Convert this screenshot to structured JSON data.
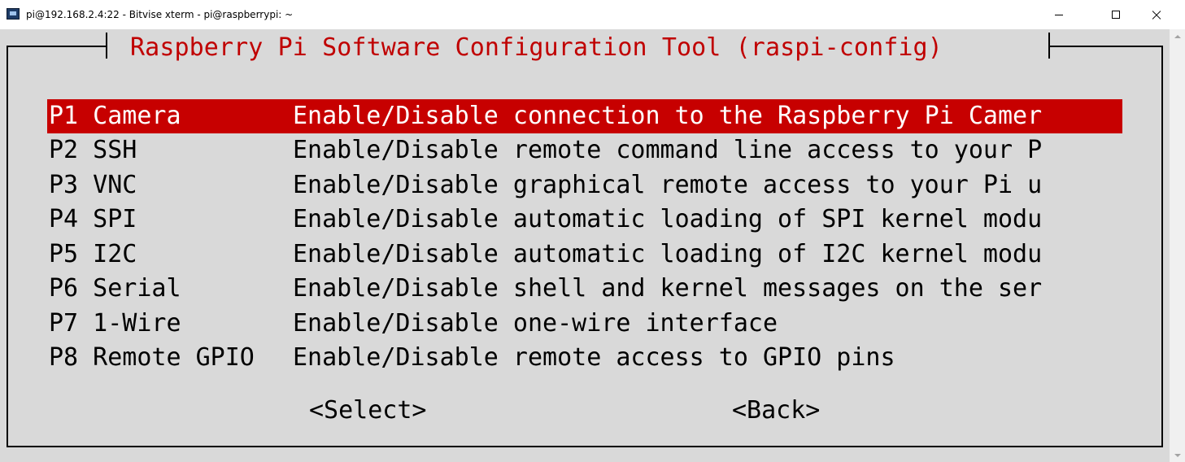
{
  "window": {
    "title": "pi@192.168.2.4:22 - Bitvise xterm - pi@raspberrypi: ~",
    "app_icon": "terminal-icon",
    "controls": {
      "minimize_icon": "minimize-icon",
      "maximize_icon": "maximize-icon",
      "close_icon": "close-icon"
    }
  },
  "dialog": {
    "title": "Raspberry Pi Software Configuration Tool (raspi-config)",
    "items": [
      {
        "key": "P1 Camera",
        "description": "Enable/Disable connection to the Raspberry Pi Camer",
        "selected": true
      },
      {
        "key": "P2 SSH",
        "description": "Enable/Disable remote command line access to your P",
        "selected": false
      },
      {
        "key": "P3 VNC",
        "description": "Enable/Disable graphical remote access to your Pi u",
        "selected": false
      },
      {
        "key": "P4 SPI",
        "description": "Enable/Disable automatic loading of SPI kernel modu",
        "selected": false
      },
      {
        "key": "P5 I2C",
        "description": "Enable/Disable automatic loading of I2C kernel modu",
        "selected": false
      },
      {
        "key": "P6 Serial",
        "description": "Enable/Disable shell and kernel messages on the ser",
        "selected": false
      },
      {
        "key": "P7 1-Wire",
        "description": "Enable/Disable one-wire interface",
        "selected": false
      },
      {
        "key": "P8 Remote GPIO",
        "description": "Enable/Disable remote access to GPIO pins",
        "selected": false
      }
    ],
    "select_label": "<Select>",
    "back_label": "<Back>"
  },
  "colors": {
    "terminal_bg": "#d9d9d9",
    "title_red": "#c00000",
    "selection_red": "#c70000",
    "text": "#000000"
  },
  "scrollbar": {
    "up_icon": "arrow-up-icon",
    "down_icon": "arrow-down-icon"
  }
}
